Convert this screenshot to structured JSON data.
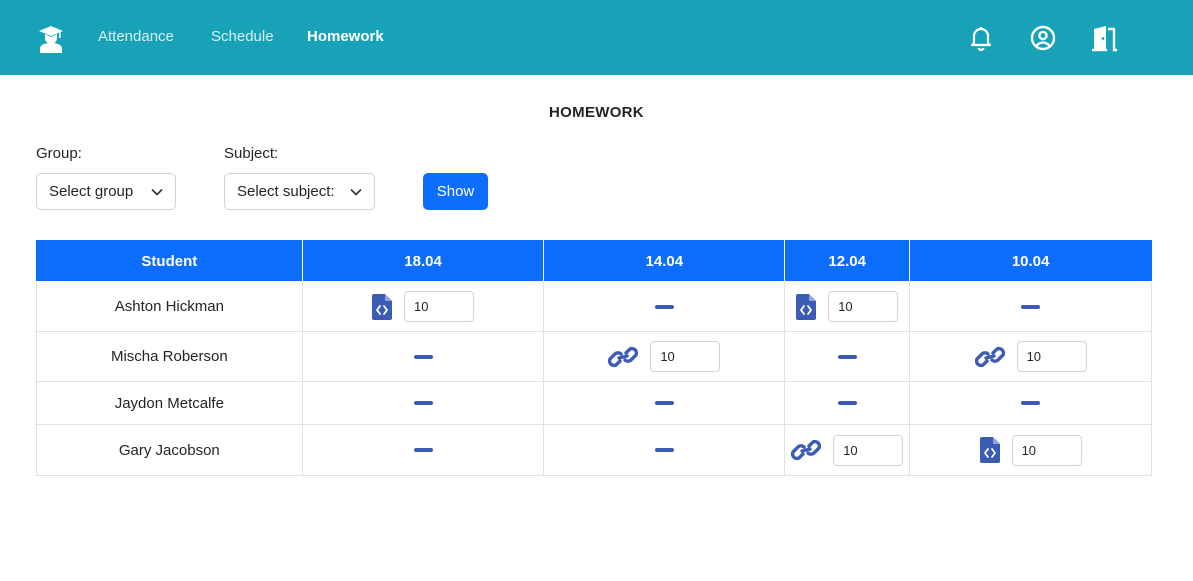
{
  "nav": {
    "links": [
      "Attendance",
      "Schedule",
      "Homework"
    ],
    "active": "Homework",
    "icons": [
      "graduation-cap-icon",
      "bell-icon",
      "user-circle-icon",
      "door-exit-icon"
    ],
    "bg_color": "#17a2b8"
  },
  "page": {
    "title": "HOMEWORK"
  },
  "filters": {
    "group_label": "Group:",
    "group_value": "Select group",
    "subject_label": "Subject:",
    "subject_value": "Select subject:",
    "show_label": "Show"
  },
  "table": {
    "header_color": "#0d6efd",
    "columns": [
      "Student",
      "18.04",
      "14.04",
      "12.04",
      "10.04"
    ],
    "rows": [
      {
        "student": "Ashton Hickman",
        "cells": [
          {
            "type": "file",
            "grade": "10"
          },
          {
            "type": "none"
          },
          {
            "type": "file",
            "grade": "10"
          },
          {
            "type": "none"
          }
        ]
      },
      {
        "student": "Mischa Roberson",
        "cells": [
          {
            "type": "none"
          },
          {
            "type": "link",
            "grade": "10"
          },
          {
            "type": "none"
          },
          {
            "type": "link",
            "grade": "10"
          }
        ]
      },
      {
        "student": "Jaydon Metcalfe",
        "cells": [
          {
            "type": "none"
          },
          {
            "type": "none"
          },
          {
            "type": "none"
          },
          {
            "type": "none"
          }
        ]
      },
      {
        "student": "Gary Jacobson",
        "cells": [
          {
            "type": "none"
          },
          {
            "type": "none"
          },
          {
            "type": "link",
            "grade": "10"
          },
          {
            "type": "file",
            "grade": "10"
          }
        ]
      }
    ]
  }
}
